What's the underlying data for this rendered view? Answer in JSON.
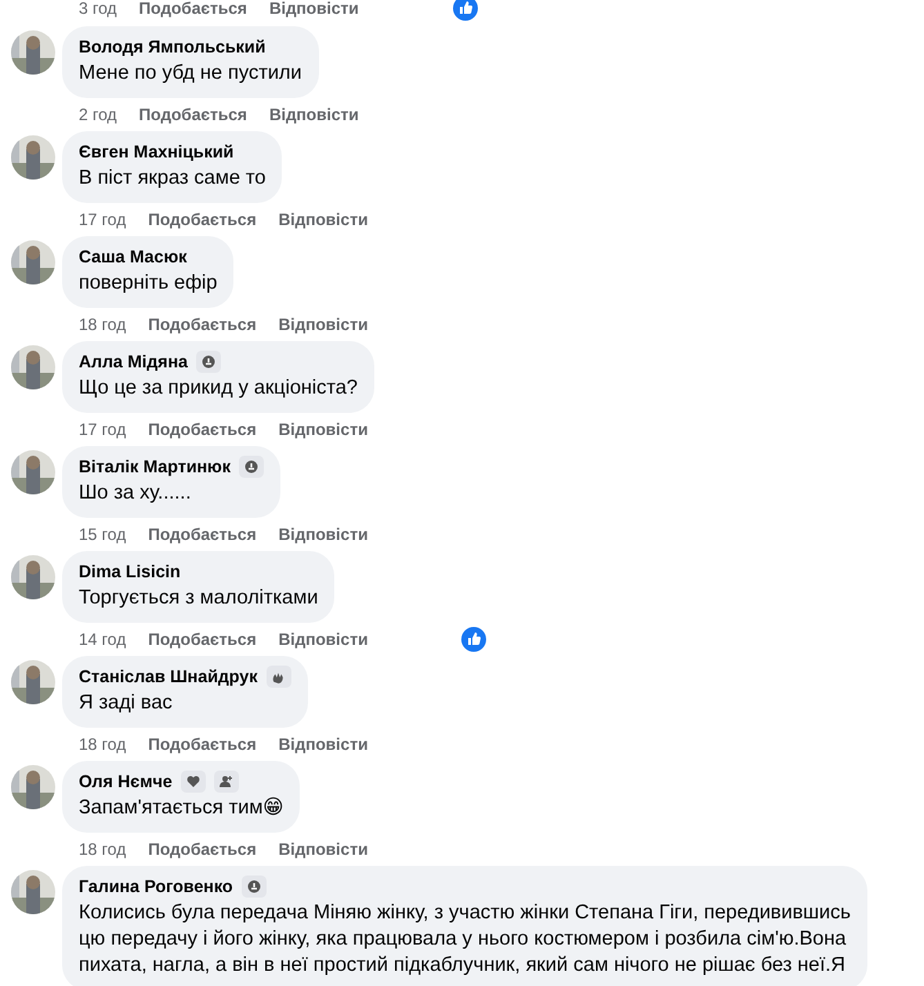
{
  "top_meta": {
    "time": "3 год",
    "like": "Подобається",
    "reply": "Відповісти",
    "liked": true
  },
  "comments": [
    {
      "author": "Володя Ямпольський",
      "text_lines": [
        "Мене по убд не пустили"
      ],
      "time": "2 год",
      "like": "Подобається",
      "reply": "Відповісти",
      "liked": false
    },
    {
      "author": "Євген Махніцький",
      "text_lines": [
        "В піст якраз саме то"
      ],
      "time": "17 год",
      "like": "Подобається",
      "reply": "Відповісти",
      "liked": false
    },
    {
      "author": "Саша Масюк",
      "text_lines": [
        "поверніть ефір"
      ],
      "time": "18 год",
      "like": "Подобається",
      "reply": "Відповісти",
      "liked": false
    },
    {
      "author": "Алла Мідяна",
      "badges": [
        {
          "kind": "top-fan"
        }
      ],
      "text_lines": [
        "Що це за прикид у акціоніста?"
      ],
      "time": "17 год",
      "like": "Подобається",
      "reply": "Відповісти",
      "liked": false
    },
    {
      "author": "Віталік Мартинюк",
      "badges": [
        {
          "kind": "top-fan"
        }
      ],
      "text_lines": [
        "Шо за ху......"
      ],
      "time": "15 год",
      "like": "Подобається",
      "reply": "Відповісти",
      "liked": false
    },
    {
      "author": "Dima Lisicin",
      "text_lines": [
        "Торгується з малолітками"
      ],
      "time": "14 год",
      "like": "Подобається",
      "reply": "Відповісти",
      "liked": true
    },
    {
      "author": "Станіслав Шнайдрук",
      "badges": [
        {
          "kind": "wave"
        }
      ],
      "text_lines": [
        "Я заді вас"
      ],
      "time": "18 год",
      "like": "Подобається",
      "reply": "Відповісти",
      "liked": false
    },
    {
      "author": "Оля Нємче",
      "badges": [
        {
          "kind": "heart"
        },
        {
          "kind": "person-add"
        }
      ],
      "text_lines": [
        "Запам'ятається тим😁"
      ],
      "time": "18 год",
      "like": "Подобається",
      "reply": "Відповісти",
      "liked": false
    },
    {
      "author": "Галина Роговенко",
      "badges": [
        {
          "kind": "top-fan"
        }
      ],
      "text_lines": [
        "Колисись була передача Міняю жінку, з участю жінки Степана Гіги, передивившись",
        "цю передачу і його жінку, яка працювала у нього костюмером і розбила сім'ю.Вона",
        "пихата, нагла, а він в неї простий підкаблучник, який сам нічого не рішає без неї.Я"
      ]
    }
  ]
}
